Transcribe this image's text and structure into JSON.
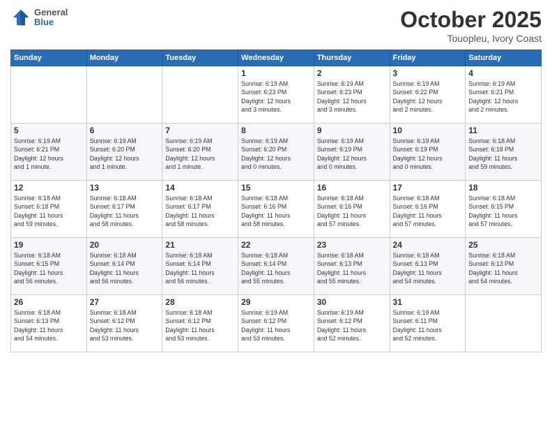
{
  "logo": {
    "general": "General",
    "blue": "Blue"
  },
  "header": {
    "month": "October 2025",
    "location": "Touopleu, Ivory Coast"
  },
  "days_of_week": [
    "Sunday",
    "Monday",
    "Tuesday",
    "Wednesday",
    "Thursday",
    "Friday",
    "Saturday"
  ],
  "weeks": [
    [
      {
        "day": "",
        "info": ""
      },
      {
        "day": "",
        "info": ""
      },
      {
        "day": "",
        "info": ""
      },
      {
        "day": "1",
        "info": "Sunrise: 6:19 AM\nSunset: 6:23 PM\nDaylight: 12 hours\nand 3 minutes."
      },
      {
        "day": "2",
        "info": "Sunrise: 6:19 AM\nSunset: 6:23 PM\nDaylight: 12 hours\nand 3 minutes."
      },
      {
        "day": "3",
        "info": "Sunrise: 6:19 AM\nSunset: 6:22 PM\nDaylight: 12 hours\nand 2 minutes."
      },
      {
        "day": "4",
        "info": "Sunrise: 6:19 AM\nSunset: 6:21 PM\nDaylight: 12 hours\nand 2 minutes."
      }
    ],
    [
      {
        "day": "5",
        "info": "Sunrise: 6:19 AM\nSunset: 6:21 PM\nDaylight: 12 hours\nand 1 minute."
      },
      {
        "day": "6",
        "info": "Sunrise: 6:19 AM\nSunset: 6:20 PM\nDaylight: 12 hours\nand 1 minute."
      },
      {
        "day": "7",
        "info": "Sunrise: 6:19 AM\nSunset: 6:20 PM\nDaylight: 12 hours\nand 1 minute."
      },
      {
        "day": "8",
        "info": "Sunrise: 6:19 AM\nSunset: 6:20 PM\nDaylight: 12 hours\nand 0 minutes."
      },
      {
        "day": "9",
        "info": "Sunrise: 6:19 AM\nSunset: 6:19 PM\nDaylight: 12 hours\nand 0 minutes."
      },
      {
        "day": "10",
        "info": "Sunrise: 6:19 AM\nSunset: 6:19 PM\nDaylight: 12 hours\nand 0 minutes."
      },
      {
        "day": "11",
        "info": "Sunrise: 6:18 AM\nSunset: 6:18 PM\nDaylight: 11 hours\nand 59 minutes."
      }
    ],
    [
      {
        "day": "12",
        "info": "Sunrise: 6:18 AM\nSunset: 6:18 PM\nDaylight: 11 hours\nand 59 minutes."
      },
      {
        "day": "13",
        "info": "Sunrise: 6:18 AM\nSunset: 6:17 PM\nDaylight: 11 hours\nand 58 minutes."
      },
      {
        "day": "14",
        "info": "Sunrise: 6:18 AM\nSunset: 6:17 PM\nDaylight: 11 hours\nand 58 minutes."
      },
      {
        "day": "15",
        "info": "Sunrise: 6:18 AM\nSunset: 6:16 PM\nDaylight: 11 hours\nand 58 minutes."
      },
      {
        "day": "16",
        "info": "Sunrise: 6:18 AM\nSunset: 6:16 PM\nDaylight: 11 hours\nand 57 minutes."
      },
      {
        "day": "17",
        "info": "Sunrise: 6:18 AM\nSunset: 6:16 PM\nDaylight: 11 hours\nand 57 minutes."
      },
      {
        "day": "18",
        "info": "Sunrise: 6:18 AM\nSunset: 6:15 PM\nDaylight: 11 hours\nand 57 minutes."
      }
    ],
    [
      {
        "day": "19",
        "info": "Sunrise: 6:18 AM\nSunset: 6:15 PM\nDaylight: 11 hours\nand 56 minutes."
      },
      {
        "day": "20",
        "info": "Sunrise: 6:18 AM\nSunset: 6:14 PM\nDaylight: 11 hours\nand 56 minutes."
      },
      {
        "day": "21",
        "info": "Sunrise: 6:18 AM\nSunset: 6:14 PM\nDaylight: 11 hours\nand 56 minutes."
      },
      {
        "day": "22",
        "info": "Sunrise: 6:18 AM\nSunset: 6:14 PM\nDaylight: 11 hours\nand 55 minutes."
      },
      {
        "day": "23",
        "info": "Sunrise: 6:18 AM\nSunset: 6:13 PM\nDaylight: 11 hours\nand 55 minutes."
      },
      {
        "day": "24",
        "info": "Sunrise: 6:18 AM\nSunset: 6:13 PM\nDaylight: 11 hours\nand 54 minutes."
      },
      {
        "day": "25",
        "info": "Sunrise: 6:18 AM\nSunset: 6:13 PM\nDaylight: 11 hours\nand 54 minutes."
      }
    ],
    [
      {
        "day": "26",
        "info": "Sunrise: 6:18 AM\nSunset: 6:13 PM\nDaylight: 11 hours\nand 54 minutes."
      },
      {
        "day": "27",
        "info": "Sunrise: 6:18 AM\nSunset: 6:12 PM\nDaylight: 11 hours\nand 53 minutes."
      },
      {
        "day": "28",
        "info": "Sunrise: 6:18 AM\nSunset: 6:12 PM\nDaylight: 11 hours\nand 53 minutes."
      },
      {
        "day": "29",
        "info": "Sunrise: 6:19 AM\nSunset: 6:12 PM\nDaylight: 11 hours\nand 53 minutes."
      },
      {
        "day": "30",
        "info": "Sunrise: 6:19 AM\nSunset: 6:12 PM\nDaylight: 11 hours\nand 52 minutes."
      },
      {
        "day": "31",
        "info": "Sunrise: 6:19 AM\nSunset: 6:11 PM\nDaylight: 11 hours\nand 52 minutes."
      },
      {
        "day": "",
        "info": ""
      }
    ]
  ]
}
